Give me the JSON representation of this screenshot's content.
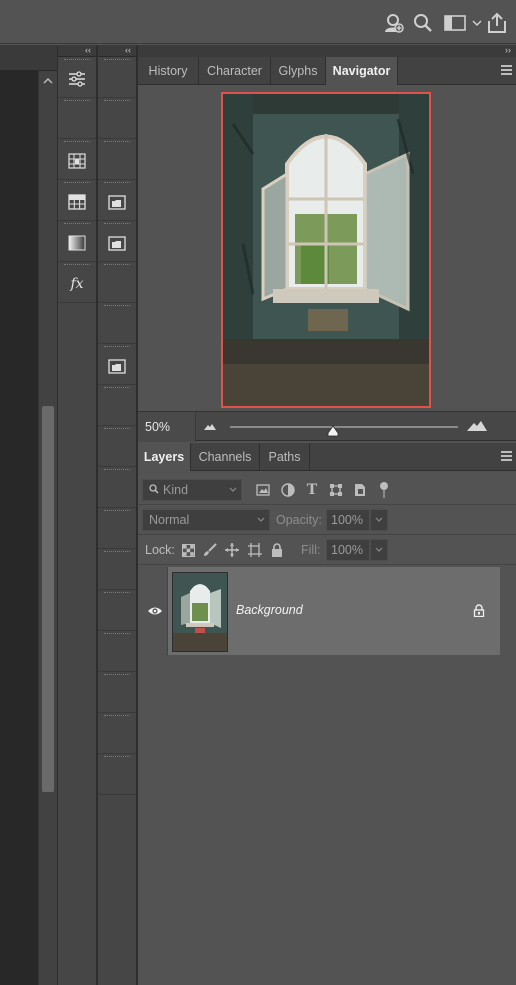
{
  "topbar": {
    "icons": [
      "user-add-icon",
      "search-icon",
      "workspace-icon",
      "chevron-down-icon",
      "share-icon"
    ]
  },
  "dock": {
    "collapse_glyph": "‹‹",
    "col1_icons": [
      "adjustments-icon",
      "histogram-grid-icon",
      "table-grid-icon",
      "gradient-icon",
      "fx-icon"
    ],
    "col2_icons": [
      "folder-icon",
      "folder-icon",
      "folder-icon"
    ],
    "fx_label": "fx"
  },
  "panels": {
    "expand_glyph": "››",
    "top_tabs": [
      {
        "label": "History",
        "active": false
      },
      {
        "label": "Character",
        "active": false
      },
      {
        "label": "Glyphs",
        "active": false
      },
      {
        "label": "Navigator",
        "active": true
      }
    ],
    "navigator": {
      "zoom": "50%",
      "zoom_slider_fraction": 0.45
    },
    "bottom_tabs": [
      {
        "label": "Layers",
        "active": true
      },
      {
        "label": "Channels",
        "active": false
      },
      {
        "label": "Paths",
        "active": false
      }
    ],
    "layers": {
      "filter_placeholder": "Kind",
      "filter_icons": [
        "image-filter-icon",
        "adjustment-filter-icon",
        "type-filter-icon",
        "shape-filter-icon",
        "smart-object-filter-icon",
        "toggle-filter-icon"
      ],
      "blend_mode": "Normal",
      "opacity_label": "Opacity:",
      "opacity_value": "100%",
      "lock_label": "Lock:",
      "lock_icons": [
        "lock-transparent-icon",
        "lock-paint-icon",
        "lock-move-icon",
        "lock-artboard-icon",
        "lock-all-icon"
      ],
      "fill_label": "Fill:",
      "fill_value": "100%",
      "items": [
        {
          "name": "Background",
          "visible": true,
          "locked": true
        }
      ]
    }
  },
  "colors": {
    "panel_bg": "#535353",
    "selected_layer": "#6d6d6d",
    "navigator_frame": "#e0524a"
  }
}
